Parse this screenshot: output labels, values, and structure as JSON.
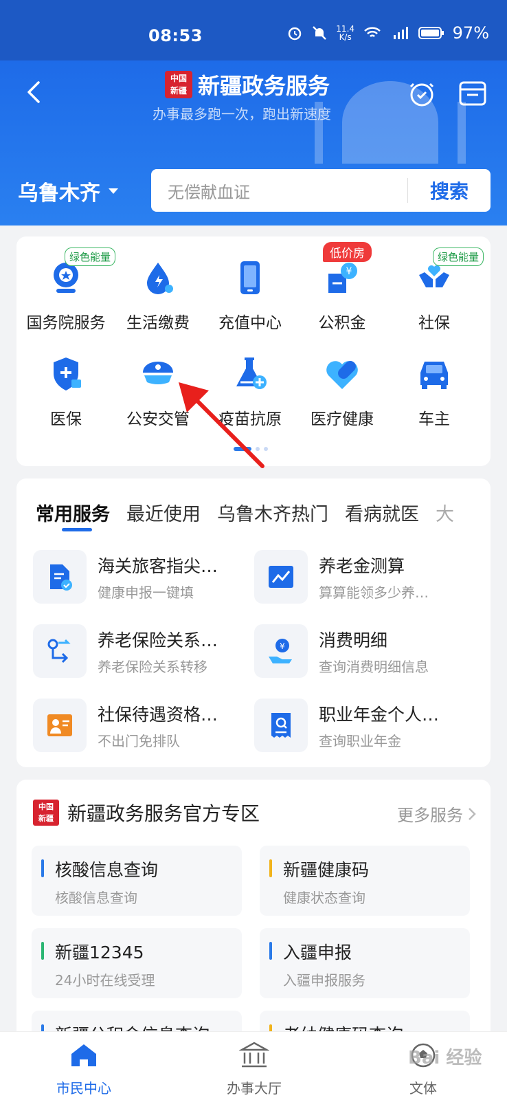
{
  "status": {
    "time": "08:53",
    "speed": "11.4\nK/s",
    "battery": "97%"
  },
  "header": {
    "logo_text": "中国\n新疆",
    "title": "新疆政务服务",
    "subtitle": "办事最多跑一次，跑出新速度",
    "city": "乌鲁木齐",
    "search_placeholder": "无偿献血证",
    "search_button": "搜索"
  },
  "grid": {
    "items": [
      {
        "label": "国务院服务",
        "badge": "绿色能量",
        "badge_type": "green",
        "icon": "state-council-icon"
      },
      {
        "label": "生活缴费",
        "badge": "",
        "icon": "utility-payment-icon"
      },
      {
        "label": "充值中心",
        "badge": "",
        "icon": "phone-recharge-icon"
      },
      {
        "label": "公积金",
        "badge": "低价房",
        "badge_type": "red",
        "icon": "housing-fund-icon"
      },
      {
        "label": "社保",
        "badge": "绿色能量",
        "badge_type": "green",
        "icon": "social-security-icon"
      },
      {
        "label": "医保",
        "badge": "",
        "icon": "medical-insurance-icon"
      },
      {
        "label": "公安交管",
        "badge": "",
        "icon": "police-cap-icon"
      },
      {
        "label": "疫苗抗原",
        "badge": "",
        "icon": "vaccine-flask-icon"
      },
      {
        "label": "医疗健康",
        "badge": "",
        "icon": "health-heart-icon"
      },
      {
        "label": "车主",
        "badge": "",
        "icon": "car-icon"
      }
    ]
  },
  "services": {
    "tabs": [
      "常用服务",
      "最近使用",
      "乌鲁木齐热门",
      "看病就医",
      "大"
    ],
    "items": [
      {
        "title": "海关旅客指尖…",
        "subtitle": "健康申报一键填",
        "icon": "document-check-icon"
      },
      {
        "title": "养老金测算",
        "subtitle": "算算能领多少养…",
        "icon": "line-chart-icon"
      },
      {
        "title": "养老保险关系…",
        "subtitle": "养老保险关系转移",
        "icon": "transfer-route-icon"
      },
      {
        "title": "消费明细",
        "subtitle": "查询消费明细信息",
        "icon": "hand-coin-icon"
      },
      {
        "title": "社保待遇资格…",
        "subtitle": "不出门免排队",
        "icon": "person-certificate-icon"
      },
      {
        "title": "职业年金个人…",
        "subtitle": "查询职业年金",
        "icon": "receipt-search-icon"
      }
    ]
  },
  "zone": {
    "logo_text": "中国\n新疆",
    "title": "新疆政务服务官方专区",
    "more": "更多服务",
    "items": [
      {
        "title": "核酸信息查询",
        "subtitle": "核酸信息查询",
        "color": "#2a7ae8"
      },
      {
        "title": "新疆健康码",
        "subtitle": "健康状态查询",
        "color": "#f1b31c"
      },
      {
        "title": "新疆12345",
        "subtitle": "24小时在线受理",
        "color": "#2bb673"
      },
      {
        "title": "入疆申报",
        "subtitle": "入疆申报服务",
        "color": "#2a7ae8"
      },
      {
        "title": "新疆公积金信息查询",
        "subtitle": "",
        "color": "#2a7ae8"
      },
      {
        "title": "老幼健康码查询",
        "subtitle": "",
        "color": "#f1b31c"
      }
    ]
  },
  "nav": {
    "items": [
      {
        "label": "市民中心",
        "active": true
      },
      {
        "label": "办事大厅",
        "active": false
      },
      {
        "label": "文体",
        "active": false
      }
    ]
  },
  "colors": {
    "primary": "#1e6be8",
    "header_dark": "#1d59c4"
  },
  "watermark": "Bai 经验"
}
